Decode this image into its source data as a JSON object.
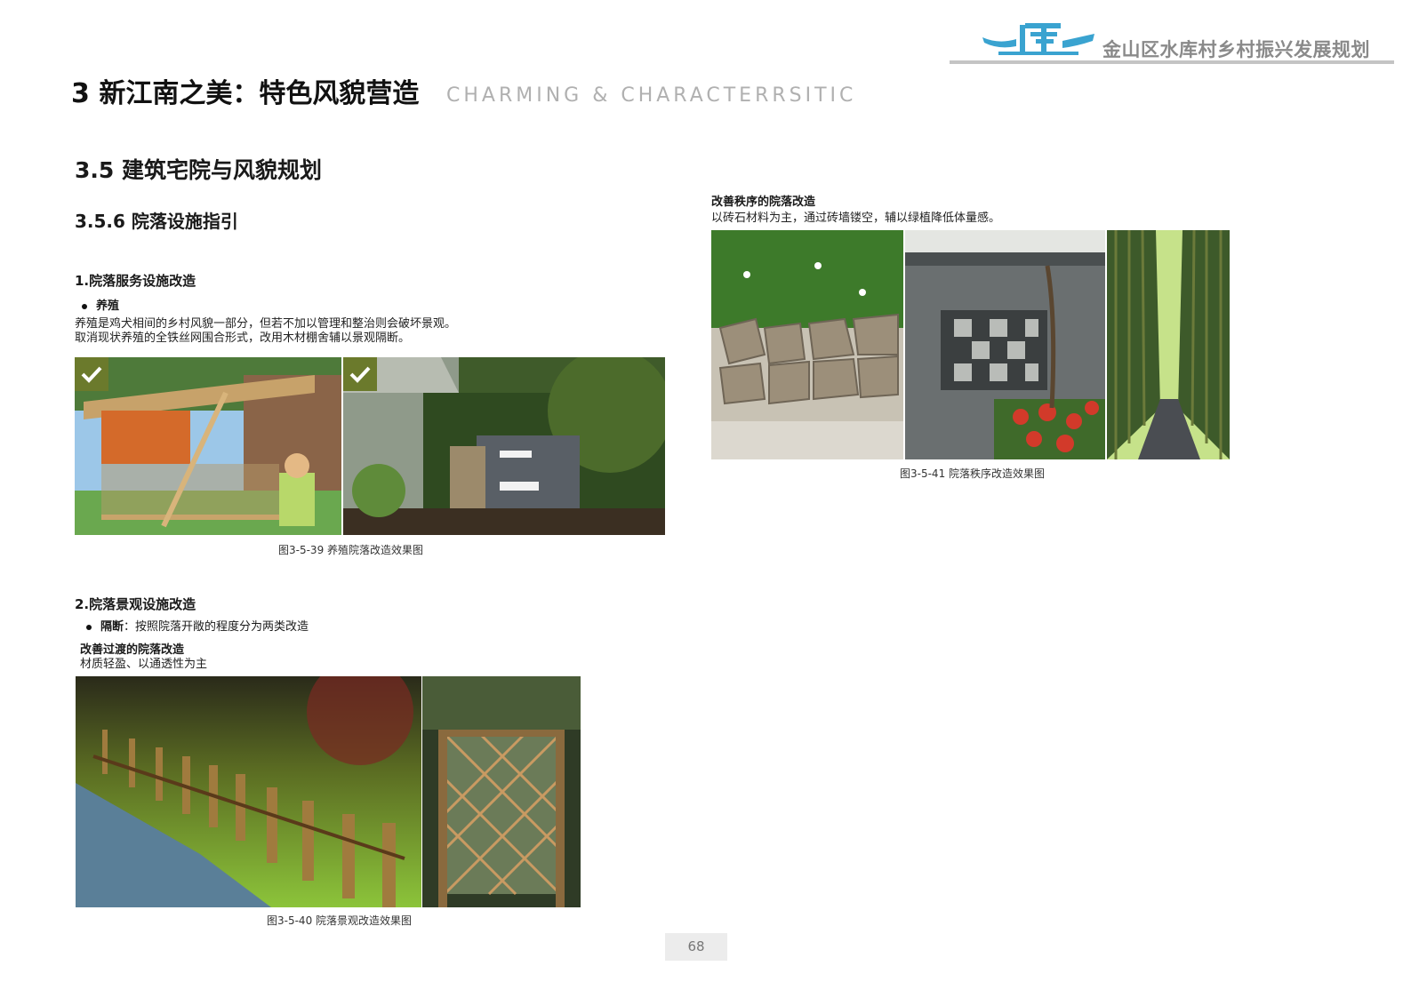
{
  "header": {
    "brand_title": "金山区水库村乡村振兴发展规划",
    "chapter_title": "3 新江南之美：特色风貌营造",
    "chapter_subtitle": "CHARMING & CHARACTERRSITIC",
    "accent_color": "#3aa3d0"
  },
  "section": {
    "title": "3.5 建筑宅院与风貌规划",
    "subtitle": "3.5.6 院落设施指引"
  },
  "part1": {
    "heading": "1.院落服务设施改造",
    "bullet": "养殖",
    "paragraph": [
      "养殖是鸡犬相间的乡村风貌一部分，但若不加以管理和整治则会破坏景观。",
      "取消现状养殖的全铁丝网围合形式，改用木材棚舍辅以景观隔断。"
    ],
    "caption": "图3-5-39 养殖院落改造效果图",
    "photos": [
      "chicken-coop-photo",
      "modern-coop-photo"
    ]
  },
  "part2": {
    "heading": "2.院落景观设施改造",
    "bullet_label": "隔断",
    "bullet_text": "：按照院落开敞的程度分为两类改造",
    "sub_label": "改善过渡的院落改造",
    "sub_text": "材质轻盈、以通透性为主",
    "caption": "图3-5-40 院落景观改造效果图",
    "photos": [
      "bamboo-fence-photo",
      "lattice-gate-photo"
    ]
  },
  "part3": {
    "label": "改善秩序的院落改造",
    "text": "以砖石材料为主，通过砖墙镂空，辅以绿植降低体量感。",
    "caption": "图3-5-41 院落秩序改造效果图",
    "photos": [
      "stone-wall-ivy-photo",
      "brick-lattice-wall-photo",
      "bamboo-path-photo"
    ]
  },
  "footer": {
    "page_number": "68"
  }
}
